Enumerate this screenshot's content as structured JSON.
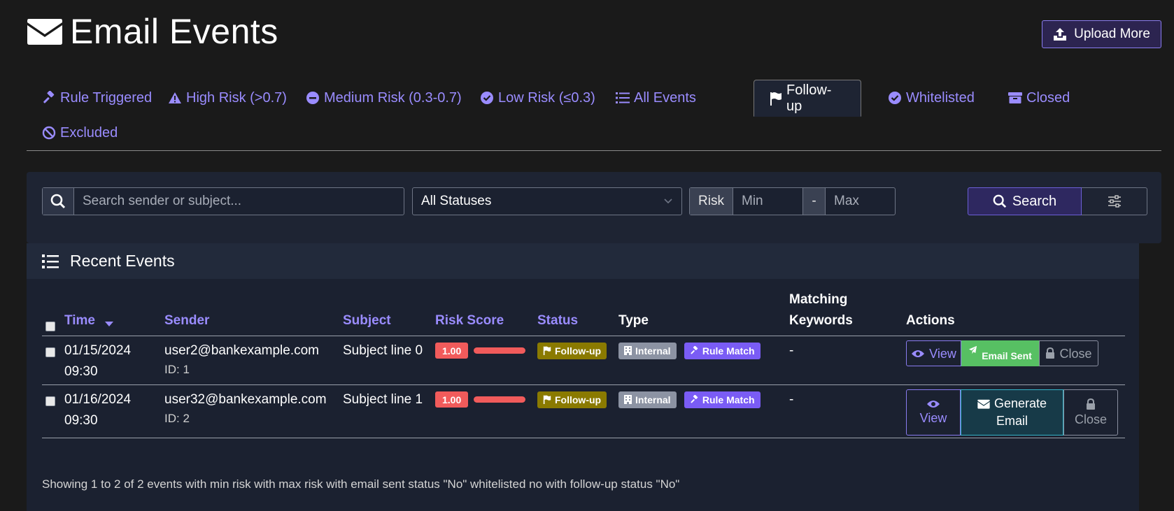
{
  "page": {
    "title": "Email Events",
    "upload_label": "Upload More"
  },
  "tabs": [
    {
      "label": "Rule Triggered",
      "icon": "gavel-icon"
    },
    {
      "label": "High Risk (>0.7)",
      "icon": "warning-icon"
    },
    {
      "label": "Medium Risk (0.3-0.7)",
      "icon": "minus-circle-icon"
    },
    {
      "label": "Low Risk (≤0.3)",
      "icon": "check-circle-icon"
    },
    {
      "label": "All Events",
      "icon": "list-icon"
    },
    {
      "label": "Follow-up",
      "icon": "flag-icon",
      "active": true
    },
    {
      "label": "Whitelisted",
      "icon": "check-circle-icon"
    },
    {
      "label": "Closed",
      "icon": "archive-icon"
    },
    {
      "label": "Excluded",
      "icon": "ban-icon"
    }
  ],
  "filters": {
    "search_placeholder": "Search sender or subject...",
    "status_value": "All Statuses",
    "risk_label": "Risk",
    "min_placeholder": "Min",
    "dash": "-",
    "max_placeholder": "Max",
    "search_label": "Search"
  },
  "card": {
    "title": "Recent Events",
    "columns": {
      "time": "Time",
      "sender": "Sender",
      "subject": "Subject",
      "risk_score": "Risk Score",
      "status": "Status",
      "type": "Type",
      "keywords_1": "Matching",
      "keywords_2": "Keywords",
      "actions": "Actions"
    },
    "rows": [
      {
        "date": "01/15/2024",
        "time": "09:30",
        "sender": "user2@bankexample.com",
        "id": "ID: 1",
        "subject": "Subject line 0",
        "score": "1.00",
        "score_value": 1.0,
        "status": "Follow-up",
        "type": "Internal",
        "rule": "Rule Match",
        "keywords": "-",
        "view": "View",
        "middle": "Email Sent",
        "close": "Close"
      },
      {
        "date": "01/16/2024",
        "time": "09:30",
        "sender": "user32@bankexample.com",
        "id": "ID: 2",
        "subject": "Subject line 1",
        "score": "1.00",
        "score_value": 1.0,
        "status": "Follow-up",
        "type": "Internal",
        "rule": "Rule Match",
        "keywords": "-",
        "view": "View",
        "middle_1": "Generate",
        "middle_2": "Email",
        "close": "Close"
      }
    ],
    "footer": "Showing 1 to 2 of 2 events with min risk with max risk with email sent status \"No\" whitelisted no with follow-up status \"No\""
  },
  "colors": {
    "accent": "#9a8cff",
    "score_red": "#f15b5b",
    "followup": "#8a7a00",
    "internal": "#8c93a3",
    "rule": "#7a5cf5",
    "sent_green": "#57c063"
  }
}
